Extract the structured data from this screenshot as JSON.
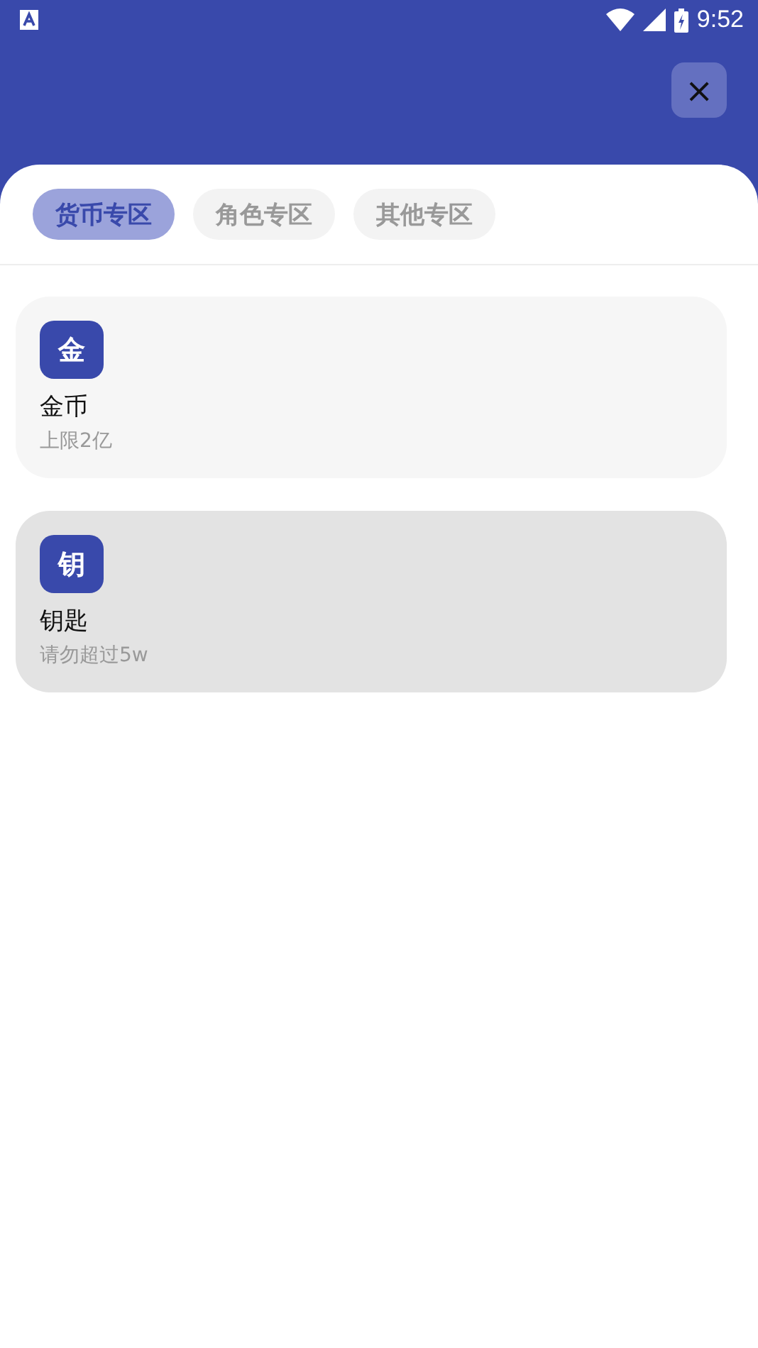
{
  "status_bar": {
    "time": "9:52"
  },
  "close_button": {
    "label": "×"
  },
  "tabs": [
    {
      "label": "货币专区",
      "selected": true
    },
    {
      "label": "角色专区",
      "selected": false
    },
    {
      "label": "其他专区",
      "selected": false
    }
  ],
  "items": [
    {
      "badge": "金",
      "name": "金币",
      "note": "上限2亿",
      "selected": false
    },
    {
      "badge": "钥",
      "name": "钥匙",
      "note": "请勿超过5w",
      "selected": true
    }
  ]
}
